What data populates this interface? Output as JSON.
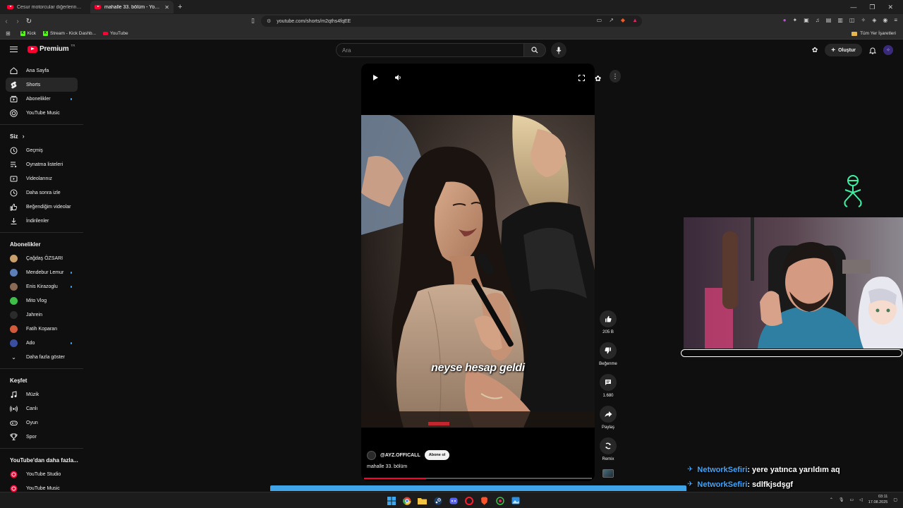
{
  "browser": {
    "tabs": [
      {
        "title": "Cesur motorcular diğerlerinden nasıl",
        "active": false
      },
      {
        "title": "mahalle 33. bölüm - YouTube",
        "active": true
      }
    ],
    "url": "youtube.com/shorts/m2qths4fqEE",
    "bookmarks": [
      "Kick",
      "Stream - Kick Dashb...",
      "YouTube"
    ],
    "all_bookmarks": "Tüm Yer İşaretleri"
  },
  "masthead": {
    "logo": "Premium",
    "logo_country": "TR",
    "search_placeholder": "Ara",
    "create_label": "Oluştur"
  },
  "sidebar": {
    "main": [
      {
        "label": "Ana Sayfa",
        "icon": "home-icon"
      },
      {
        "label": "Shorts",
        "icon": "shorts-icon",
        "active": true
      },
      {
        "label": "Abonelikler",
        "icon": "subscriptions-icon",
        "dot": true
      },
      {
        "label": "YouTube Music",
        "icon": "music-icon"
      }
    ],
    "you_title": "Siz",
    "you": [
      {
        "label": "Geçmiş",
        "icon": "history-icon"
      },
      {
        "label": "Oynatma listeleri",
        "icon": "playlists-icon"
      },
      {
        "label": "Videolarınız",
        "icon": "your-videos-icon"
      },
      {
        "label": "Daha sonra izle",
        "icon": "watch-later-icon"
      },
      {
        "label": "Beğendiğim videolar",
        "icon": "liked-icon"
      },
      {
        "label": "İndirilenler",
        "icon": "download-icon"
      }
    ],
    "subs_title": "Abonelikler",
    "subs": [
      {
        "label": "Çağdaş ÖZSARI",
        "color": "#c9a06b",
        "dot": false
      },
      {
        "label": "Mendebur Lemur",
        "color": "#5b7fb8",
        "dot": true
      },
      {
        "label": "Enis Kirazoglu",
        "color": "#8a6a55",
        "dot": true
      },
      {
        "label": "Mito Vlog",
        "color": "#3fbf4a",
        "dot": false
      },
      {
        "label": "Jahrein",
        "color": "#2b2b2b",
        "dot": false
      },
      {
        "label": "Fatih Koparan",
        "color": "#d05a3a",
        "dot": false
      },
      {
        "label": "Ado",
        "color": "#3a4fa0",
        "dot": true
      }
    ],
    "show_more": "Daha fazla göster",
    "explore_title": "Keşfet",
    "explore": [
      {
        "label": "Müzik",
        "icon": "music-note-icon"
      },
      {
        "label": "Canlı",
        "icon": "live-icon"
      },
      {
        "label": "Oyun",
        "icon": "gaming-icon"
      },
      {
        "label": "Spor",
        "icon": "trophy-icon"
      }
    ],
    "more_title": "YouTube'dan daha fazla...",
    "more": [
      {
        "label": "YouTube Studio"
      },
      {
        "label": "YouTube Music"
      }
    ]
  },
  "short": {
    "caption": "neyse hesap geldi",
    "channel": "@AYZ.OFFICALL",
    "subscribe": "Abone ol",
    "title": "mahalle 33. bölüm",
    "progress": 0.27
  },
  "actions": [
    {
      "label": "205 B",
      "icon": "like-icon"
    },
    {
      "label": "Beğenme",
      "icon": "dislike-icon"
    },
    {
      "label": "1.680",
      "icon": "comment-icon"
    },
    {
      "label": "Paylaş",
      "icon": "share-icon"
    },
    {
      "label": "Remix",
      "icon": "remix-icon"
    }
  ],
  "chat": [
    {
      "user": "NetworkSefiri",
      "msg": ": yere yatınca yarıldım aq"
    },
    {
      "user": "NetworkSefiri",
      "msg": ": sdlfkjsdşgf"
    }
  ],
  "clock": {
    "time": "03:11",
    "date": "17.08.2025"
  },
  "colors": {
    "accent": "#ff0033",
    "link": "#3ea6ff",
    "kick": "#53fc18"
  }
}
